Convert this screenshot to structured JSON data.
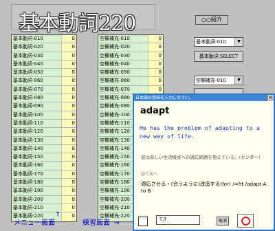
{
  "app": {
    "title": "基本動詞220",
    "intro_button": "○○紹介"
  },
  "list_left": [
    {
      "label": "基本動詞-010",
      "value": "0"
    },
    {
      "label": "基本動詞-020",
      "value": "0"
    },
    {
      "label": "基本動詞-030",
      "value": "0"
    },
    {
      "label": "基本動詞-040",
      "value": "0"
    },
    {
      "label": "基本動詞-050",
      "value": "0"
    },
    {
      "label": "基本動詞-060",
      "value": "0"
    },
    {
      "label": "基本動詞-070",
      "value": "0"
    },
    {
      "label": "基本動詞-080",
      "value": "0"
    },
    {
      "label": "基本動詞-090",
      "value": "0"
    },
    {
      "label": "基本動詞-100",
      "value": "0"
    },
    {
      "label": "基本動詞-110",
      "value": "0"
    },
    {
      "label": "基本動詞-120",
      "value": "0"
    },
    {
      "label": "基本動詞-130",
      "value": "0"
    },
    {
      "label": "基本動詞-140",
      "value": "0"
    },
    {
      "label": "基本動詞-150",
      "value": "0"
    },
    {
      "label": "基本動詞-160",
      "value": "0"
    },
    {
      "label": "基本動詞-170",
      "value": "0"
    },
    {
      "label": "基本動詞-180",
      "value": "0"
    },
    {
      "label": "基本動詞-190",
      "value": "0"
    },
    {
      "label": "基本動詞-200",
      "value": "0"
    },
    {
      "label": "基本動詞-210",
      "value": "0"
    },
    {
      "label": "基本動詞-220",
      "value": "0"
    }
  ],
  "list_right": [
    {
      "label": "空欄補充-010",
      "value": "0"
    },
    {
      "label": "空欄補充-020",
      "value": "0"
    },
    {
      "label": "空欄補充-030",
      "value": "0"
    },
    {
      "label": "空欄補充-040",
      "value": "0"
    },
    {
      "label": "空欄補充-050",
      "value": "0"
    },
    {
      "label": "空欄補充-060",
      "value": "0"
    },
    {
      "label": "空欄補充-070",
      "value": "0"
    },
    {
      "label": "空欄補充-080",
      "value": "0"
    },
    {
      "label": "空欄補充-090",
      "value": "0"
    },
    {
      "label": "空欄補充-100",
      "value": "0"
    },
    {
      "label": "空欄補充-110",
      "value": "0"
    },
    {
      "label": "空欄補充-120",
      "value": "0"
    },
    {
      "label": "空欄補充-130",
      "value": "0"
    },
    {
      "label": "空欄補充-140",
      "value": "0"
    },
    {
      "label": "空欄補充-150",
      "value": "0"
    },
    {
      "label": "空欄補充-160",
      "value": "0"
    },
    {
      "label": "空欄補充-170",
      "value": "0"
    },
    {
      "label": "空欄補充-180",
      "value": "0"
    },
    {
      "label": "空欄補充-190",
      "value": "0"
    },
    {
      "label": "空欄補充-200",
      "value": "0"
    },
    {
      "label": "空欄補充-210",
      "value": "0"
    },
    {
      "label": "空欄補充-220",
      "value": "0"
    }
  ],
  "controls": {
    "select_basic": "基本動詞-010",
    "select_button": "基本動詞 SELECT",
    "select_blank": "空欄補充-010"
  },
  "dialog": {
    "title": "日本語の意味を入力しなさい。",
    "close": "×",
    "word": "adapt",
    "example_en": "He has the problem of adapting to a new way of life.",
    "example_jp": "彼は新しい生活様式への適応問題を抱えている。(センター)",
    "reference": "@で次へ",
    "meaning": "適応させる・(合うように)改造する(for) /=fit /adapt A to B",
    "answer_value": "てき",
    "cancel_label": "取消"
  },
  "nav": {
    "menu": "メニュー画面",
    "practice": "練習画面",
    "practice_arrow": "→",
    "menu_arrow": "↑"
  }
}
